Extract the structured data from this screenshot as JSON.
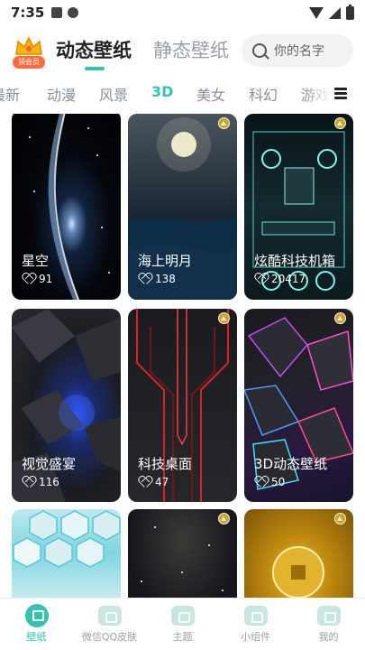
{
  "status_bar": {
    "time": "7:35"
  },
  "header": {
    "vip_label": "领会员",
    "tab_active": "动态壁纸",
    "tab_inactive": "静态壁纸",
    "search_placeholder": "你的名字"
  },
  "categories": [
    "最新",
    "动漫",
    "风景",
    "3D",
    "美女",
    "科幻",
    "游戏"
  ],
  "active_category": "3D",
  "cards": [
    {
      "title": "星空",
      "likes": "91"
    },
    {
      "title": "海上明月",
      "likes": "138"
    },
    {
      "title": "炫酷科技机箱",
      "likes": "20417"
    },
    {
      "title": "视觉盛宴",
      "likes": "116"
    },
    {
      "title": "科技桌面",
      "likes": "47"
    },
    {
      "title": "3D动态壁纸",
      "likes": "50"
    }
  ],
  "nav": [
    {
      "label": "壁纸",
      "active": true
    },
    {
      "label": "微信QQ皮肤",
      "active": false
    },
    {
      "label": "主题",
      "active": false
    },
    {
      "label": "小组件",
      "active": false
    },
    {
      "label": "我的",
      "active": false
    }
  ],
  "colors": {
    "accent": "#36c1b2",
    "inactive_text": "#9aa0a6"
  }
}
